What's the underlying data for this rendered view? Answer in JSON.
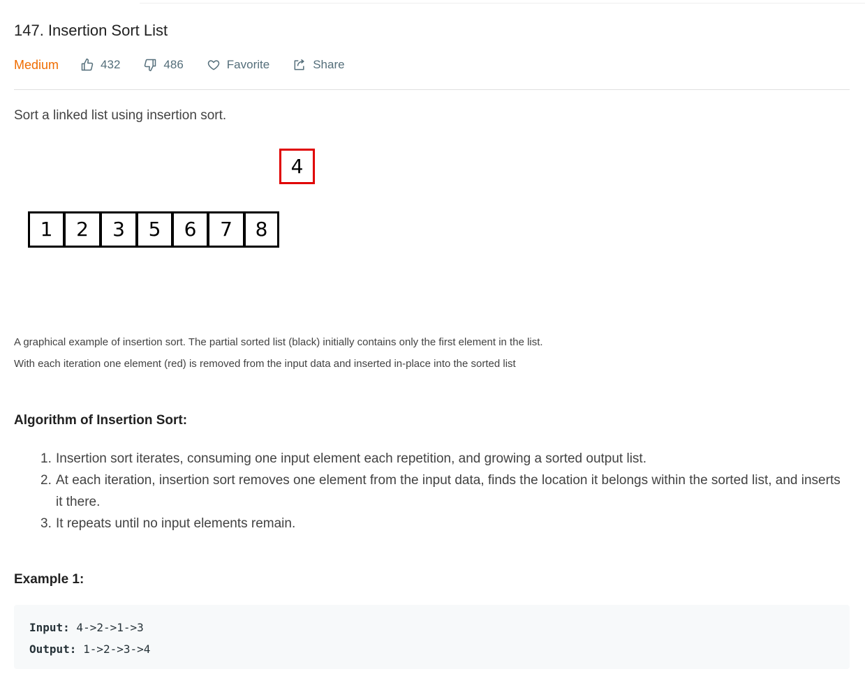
{
  "problem": {
    "title": "147. Insertion Sort List",
    "difficulty": "Medium",
    "likes": "432",
    "dislikes": "486",
    "favorite_label": "Favorite",
    "share_label": "Share",
    "description": "Sort a linked list using insertion sort."
  },
  "figure": {
    "red_value": "4",
    "sorted_values": [
      "1",
      "2",
      "3",
      "5",
      "6",
      "7",
      "8"
    ]
  },
  "caption": {
    "line1": "A graphical example of insertion sort. The partial sorted list (black) initially contains only the first element in the list.",
    "line2": "With each iteration one element (red) is removed from the input data and inserted in-place into the sorted list"
  },
  "algorithm": {
    "heading": "Algorithm of Insertion Sort:",
    "steps": [
      {
        "num": "1.",
        "text": "Insertion sort iterates, consuming one input element each repetition, and growing a sorted output list."
      },
      {
        "num": "2.",
        "text": "At each iteration, insertion sort removes one element from the input data, finds the location it belongs within the sorted list, and inserts it there."
      },
      {
        "num": "3.",
        "text": "It repeats until no input elements remain."
      }
    ]
  },
  "example": {
    "heading": "Example 1:",
    "input_label": "Input:",
    "input_value": " 4->2->1->3",
    "output_label": "Output:",
    "output_value": " 1->2->3->4"
  },
  "colors": {
    "difficulty": "#ef6c00",
    "highlight": "#e00000"
  },
  "icons": {
    "like": "thumbs-up-icon",
    "dislike": "thumbs-down-icon",
    "favorite": "heart-icon",
    "share": "share-icon"
  }
}
